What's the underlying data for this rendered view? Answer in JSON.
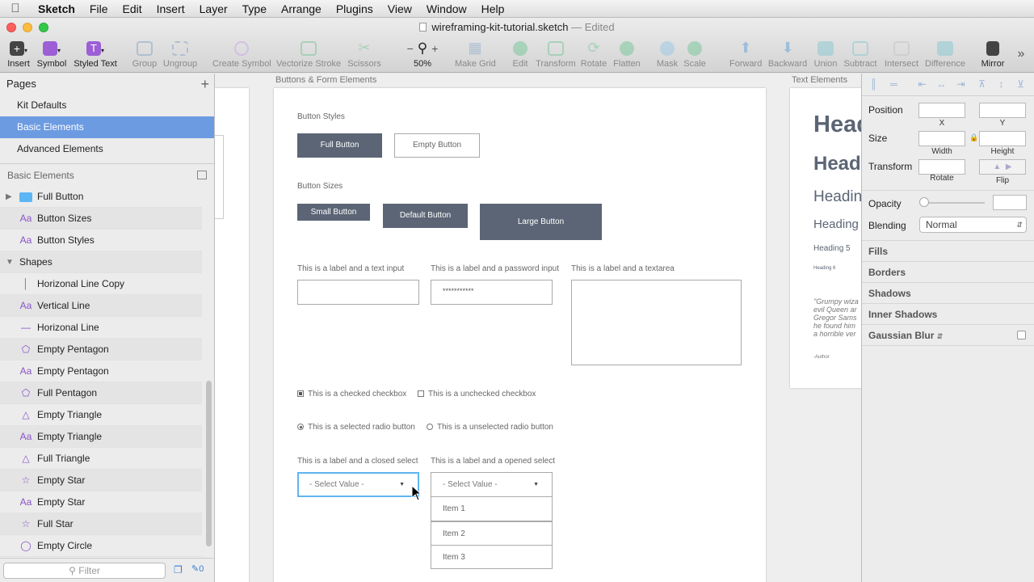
{
  "menubar": {
    "app": "Sketch",
    "items": [
      "File",
      "Edit",
      "Insert",
      "Layer",
      "Type",
      "Arrange",
      "Plugins",
      "View",
      "Window",
      "Help"
    ]
  },
  "window": {
    "title": "wireframing-kit-tutorial.sketch",
    "status": "— Edited"
  },
  "toolbar": {
    "insert": "Insert",
    "symbol": "Symbol",
    "styled_text": "Styled Text",
    "group": "Group",
    "ungroup": "Ungroup",
    "create_symbol": "Create Symbol",
    "vectorize_stroke": "Vectorize Stroke",
    "scissors": "Scissors",
    "zoom": "50%",
    "make_grid": "Make Grid",
    "edit": "Edit",
    "transform": "Transform",
    "rotate": "Rotate",
    "flatten": "Flatten",
    "mask": "Mask",
    "scale": "Scale",
    "forward": "Forward",
    "backward": "Backward",
    "union": "Union",
    "subtract": "Subtract",
    "intersect": "Intersect",
    "difference": "Difference",
    "mirror": "Mirror"
  },
  "sidebar": {
    "pages_title": "Pages",
    "pages": [
      "Kit Defaults",
      "Basic Elements",
      "Advanced Elements"
    ],
    "selected_page": "Basic Elements",
    "layers_title": "Basic Elements",
    "layers": [
      {
        "name": "Full Button",
        "icon": "folder-icon"
      },
      {
        "name": "Button Sizes",
        "icon": "text-icon"
      },
      {
        "name": "Button Styles",
        "icon": "text-icon"
      },
      {
        "name": "Shapes",
        "icon": "group"
      },
      {
        "name": "Horizonal Line Copy",
        "icon": "vertical-line-icon"
      },
      {
        "name": "Vertical Line",
        "icon": "text-icon"
      },
      {
        "name": "Horizonal Line",
        "icon": "horizontal-line-icon"
      },
      {
        "name": "Empty Pentagon",
        "icon": "pentagon-icon"
      },
      {
        "name": "Empty Pentagon",
        "icon": "text-icon"
      },
      {
        "name": "Full Pentagon",
        "icon": "pentagon-icon"
      },
      {
        "name": "Empty Triangle",
        "icon": "triangle-icon"
      },
      {
        "name": "Empty Triangle",
        "icon": "text-icon"
      },
      {
        "name": "Full Triangle",
        "icon": "triangle-icon"
      },
      {
        "name": "Empty Star",
        "icon": "star-icon"
      },
      {
        "name": "Empty Star",
        "icon": "text-icon"
      },
      {
        "name": "Full Star",
        "icon": "star-icon"
      },
      {
        "name": "Empty Circle",
        "icon": "circle-icon"
      }
    ],
    "filter_placeholder": "Filter",
    "filter_count": "0"
  },
  "canvas": {
    "artboard1_title": "Buttons & Form Elements",
    "artboard2_title": "Text Elements",
    "button_styles": "Button Styles",
    "full_button": "Full Button",
    "empty_button": "Empty Button",
    "button_sizes": "Button Sizes",
    "small_button": "Small Button",
    "default_button": "Default Button",
    "large_button": "Large Button",
    "label_text_input": "This is a label and a text input",
    "label_password_input": "This is a label and a password input",
    "password_value": "***********",
    "label_textarea": "This is a label and a textarea",
    "checked_checkbox": "This is a checked checkbox",
    "unchecked_checkbox": "This is a unchecked checkbox",
    "selected_radio": "This is a selected radio button",
    "unselected_radio": "This is a unselected radio button",
    "label_closed_select": "This is a label and a closed select",
    "label_opened_select": "This is a label and a opened select",
    "select_value": "- Select Value -",
    "items": [
      "Item 1",
      "Item 2",
      "Item 3"
    ],
    "text_elements": {
      "h1": "Head",
      "h2": "Head",
      "h3": "Headin",
      "h4": "Heading",
      "h5": "Heading 5",
      "h6": "Heading 6",
      "quote": [
        "\"Grumpy wiza",
        "evil Queen ar",
        "Gregor Sams",
        "he found him",
        "a horrible ver"
      ],
      "author": "-Author"
    }
  },
  "inspector": {
    "position": "Position",
    "x": "X",
    "y": "Y",
    "size": "Size",
    "width": "Width",
    "height": "Height",
    "transform": "Transform",
    "rotate": "Rotate",
    "flip": "Flip",
    "opacity": "Opacity",
    "blending": "Blending",
    "blending_value": "Normal",
    "fills": "Fills",
    "borders": "Borders",
    "shadows": "Shadows",
    "inner_shadows": "Inner Shadows",
    "gaussian_blur": "Gaussian Blur"
  },
  "colors": {
    "selection": "#6c9be2",
    "button_fill": "#5b6575",
    "layer_icon": "#8a55c8",
    "focus_ring": "#5fb6f2"
  }
}
